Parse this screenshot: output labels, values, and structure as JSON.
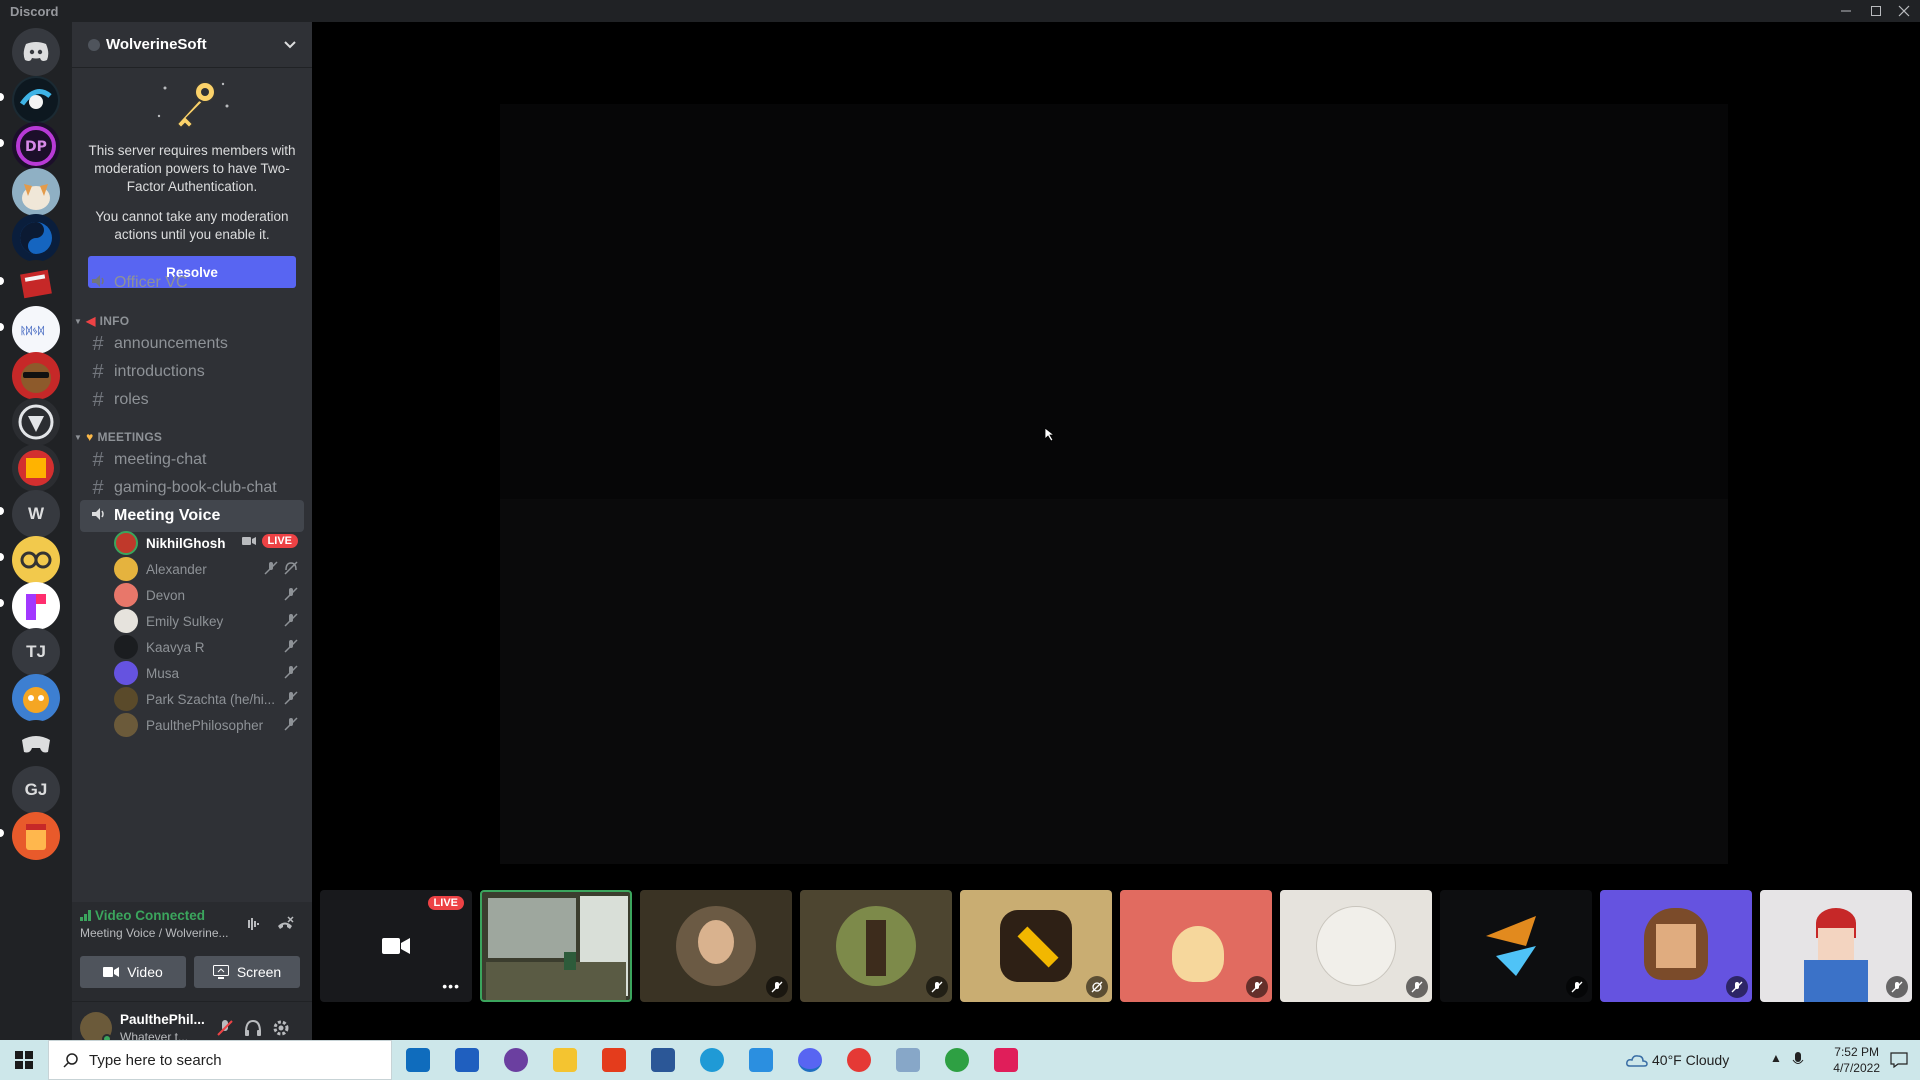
{
  "window": {
    "title": "Discord"
  },
  "server_rail": {
    "letter_items": [
      "W",
      "TJ",
      "GJ"
    ]
  },
  "server": {
    "name": "WolverineSoft",
    "notice_line1": "This server requires members with moderation powers to have Two-Factor Authentication.",
    "notice_line2": "You cannot take any moderation actions until you enable it.",
    "resolve_label": "Resolve"
  },
  "channels": {
    "officer_vc": "Officer VC",
    "cat_info": "INFO",
    "info": [
      "announcements",
      "introductions",
      "roles"
    ],
    "cat_meetings": "MEETINGS",
    "meetings": [
      "meeting-chat",
      "gaming-book-club-chat"
    ],
    "active_voice": "Meeting Voice"
  },
  "voice_users": [
    {
      "name": "NikhilGhosh",
      "badge": "LIVE"
    },
    {
      "name": "Alexander"
    },
    {
      "name": "Devon"
    },
    {
      "name": "Emily Sulkey"
    },
    {
      "name": "Kaavya R"
    },
    {
      "name": "Musa"
    },
    {
      "name": "Park Szachta (he/hi..."
    },
    {
      "name": "PaulthePhilosopher"
    }
  ],
  "voice_panel": {
    "status": "Video Connected",
    "location": "Meeting Voice / Wolverine...",
    "video_label": "Video",
    "screen_label": "Screen"
  },
  "user_panel": {
    "name": "PaulthePhil...",
    "status": "Whatever t..."
  },
  "stage": {
    "tile_badge": "LIVE"
  },
  "taskbar": {
    "search_placeholder": "Type here to search",
    "weather": "40°F  Cloudy",
    "time": "7:52 PM",
    "date": "4/7/2022"
  },
  "colors": {
    "blurple": "#5865f2",
    "green": "#3ba55d",
    "live_red": "#ed4245",
    "sidebar": "#2f3136",
    "rail": "#202225"
  }
}
